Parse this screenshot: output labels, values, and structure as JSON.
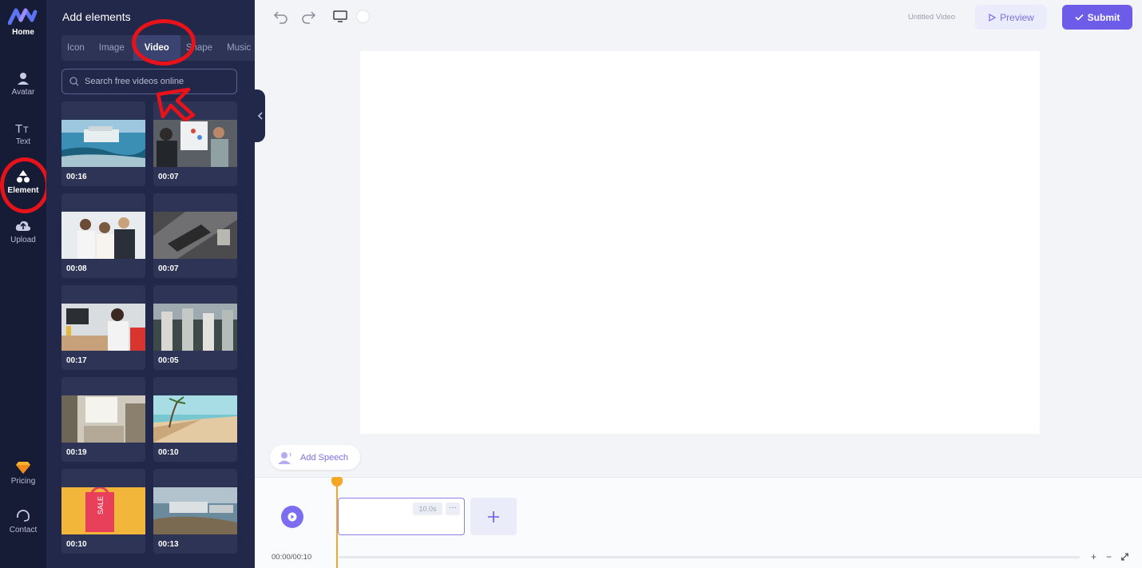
{
  "rail": {
    "items": [
      {
        "label": "Home",
        "icon": "home-logo-icon"
      },
      {
        "label": "Avatar",
        "icon": "avatar-icon"
      },
      {
        "label": "Text",
        "icon": "text-icon"
      },
      {
        "label": "Element",
        "icon": "shapes-icon",
        "active": true
      },
      {
        "label": "Upload",
        "icon": "cloud-upload-icon"
      },
      {
        "label": "Pricing",
        "icon": "diamond-icon"
      },
      {
        "label": "Contact",
        "icon": "headset-icon"
      }
    ]
  },
  "panel": {
    "title": "Add elements",
    "tabs": [
      "Icon",
      "Image",
      "Video",
      "Shape",
      "Music"
    ],
    "active_tab": "Video",
    "search_placeholder": "Search free videos online",
    "videos": [
      {
        "duration": "00:16"
      },
      {
        "duration": "00:07"
      },
      {
        "duration": "00:08"
      },
      {
        "duration": "00:07"
      },
      {
        "duration": "00:17"
      },
      {
        "duration": "00:05"
      },
      {
        "duration": "00:19"
      },
      {
        "duration": "00:10"
      },
      {
        "duration": "00:10"
      },
      {
        "duration": "00:13"
      }
    ]
  },
  "topbar": {
    "title": "Untitled Video",
    "preview_label": "Preview",
    "submit_label": "Submit"
  },
  "editor": {
    "add_speech_label": "Add Speech"
  },
  "timeline": {
    "clip_duration": "10.0s",
    "clip_more": "···",
    "time": "00:00/00:10"
  },
  "colors": {
    "accent": "#6d5ce8",
    "rail_bg": "#171c36",
    "panel_bg": "#22284a",
    "playhead": "#f5a623",
    "annotation": "#e8121a"
  }
}
